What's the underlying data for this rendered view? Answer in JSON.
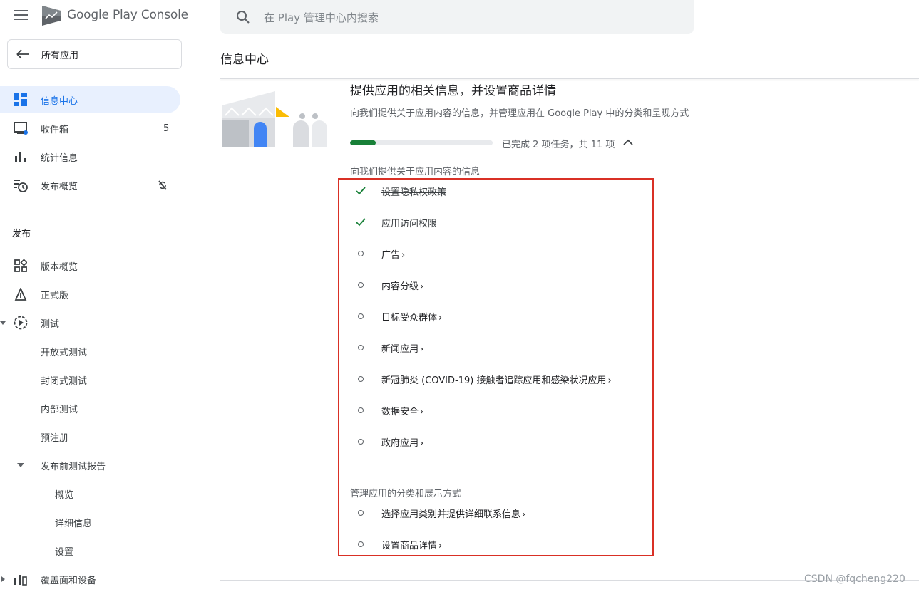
{
  "brand": {
    "part1": "Google Play",
    "part2": " Console"
  },
  "sidebar": {
    "all_apps": "所有应用",
    "top_items": [
      {
        "label": "信息中心",
        "icon": "dashboard-icon"
      },
      {
        "label": "收件箱",
        "icon": "inbox-icon",
        "badge": "5"
      },
      {
        "label": "统计信息",
        "icon": "bar-chart-icon"
      },
      {
        "label": "发布概览",
        "icon": "publishing-icon"
      }
    ],
    "section_title": "发布",
    "release_items": [
      {
        "label": "版本概览",
        "icon": "release-overview-icon"
      },
      {
        "label": "正式版",
        "icon": "production-icon"
      },
      {
        "label": "测试",
        "icon": "testing-icon"
      },
      {
        "label": "开放式测试"
      },
      {
        "label": "封闭式测试"
      },
      {
        "label": "内部测试"
      },
      {
        "label": "预注册"
      },
      {
        "label": "发布前测试报告"
      },
      {
        "label": "概览"
      },
      {
        "label": "详细信息"
      },
      {
        "label": "设置"
      },
      {
        "label": "覆盖面和设备",
        "icon": "reach-icon"
      }
    ]
  },
  "search": {
    "placeholder": "在 Play 管理中心内搜索"
  },
  "page_title": "信息中心",
  "main": {
    "heading": "提供应用的相关信息，并设置商品详情",
    "subheading": "向我们提供关于应用内容的信息，并管理应用在 Google Play 中的分类和呈现方式",
    "progress_fraction": 0.18,
    "progress_text": "已完成 2 项任务，共 11 项",
    "group1_label": "向我们提供关于应用内容的信息",
    "group1_tasks": [
      {
        "label": "设置隐私权政策",
        "done": true
      },
      {
        "label": "应用访问权限",
        "done": true
      },
      {
        "label": "广告",
        "done": false
      },
      {
        "label": "内容分级",
        "done": false
      },
      {
        "label": "目标受众群体",
        "done": false
      },
      {
        "label": "新闻应用",
        "done": false
      },
      {
        "label": "新冠肺炎 (COVID-19) 接触者追踪应用和感染状况应用",
        "done": false
      },
      {
        "label": "数据安全",
        "done": false
      },
      {
        "label": "政府应用",
        "done": false
      }
    ],
    "group2_label": "管理应用的分类和展示方式",
    "group2_tasks": [
      {
        "label": "选择应用类别并提供详细联系信息",
        "done": false
      },
      {
        "label": "设置商品详情",
        "done": false
      }
    ]
  },
  "watermark": "CSDN @fqcheng220",
  "colors": {
    "accent": "#1a73e8",
    "success": "#188038",
    "highlight_box": "#d93025"
  }
}
